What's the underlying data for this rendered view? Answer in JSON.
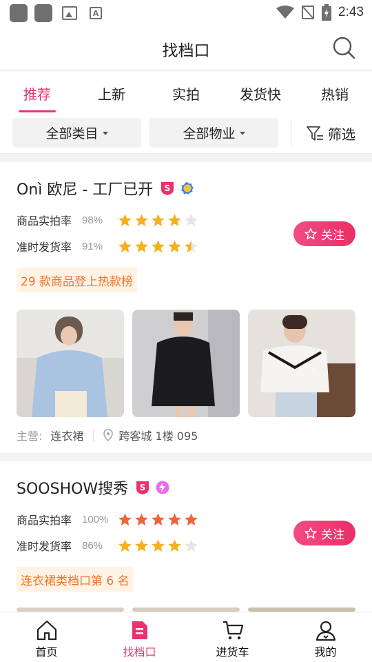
{
  "status_bar": {
    "time": "2:43"
  },
  "header": {
    "title": "找档口",
    "search_icon": "search-icon"
  },
  "tabs": [
    {
      "label": "推荐",
      "active": true
    },
    {
      "label": "上新",
      "active": false
    },
    {
      "label": "实拍",
      "active": false
    },
    {
      "label": "发货快",
      "active": false
    },
    {
      "label": "热销",
      "active": false
    }
  ],
  "filters": {
    "category_label": "全部类目",
    "property_label": "全部物业",
    "filter_label": "筛选"
  },
  "shops": [
    {
      "name": "Onì 欧尼 - 工厂已开",
      "photo_rate_label": "商品实拍率",
      "photo_rate_value": "98%",
      "photo_rate_stars": 4,
      "ontime_label": "准时发货率",
      "ontime_value": "91%",
      "ontime_stars": 4.5,
      "follow_label": "关注",
      "hot_tag": "29 款商品登上热款榜",
      "main_label": "主营:",
      "main_value": "连衣裙",
      "location": "跨客城 1楼 095"
    },
    {
      "name": "SOOSHOW搜秀",
      "photo_rate_label": "商品实拍率",
      "photo_rate_value": "100%",
      "photo_rate_stars": 5,
      "ontime_label": "准时发货率",
      "ontime_value": "86%",
      "ontime_stars": 4,
      "follow_label": "关注",
      "hot_tag": "连衣裙类档口第 6 名"
    }
  ],
  "bottom_nav": [
    {
      "label": "首页",
      "icon": "home-icon",
      "active": false
    },
    {
      "label": "找档口",
      "icon": "shop-finder-icon",
      "active": true
    },
    {
      "label": "进货车",
      "icon": "cart-icon",
      "active": false
    },
    {
      "label": "我的",
      "icon": "profile-icon",
      "active": false
    }
  ],
  "colors": {
    "accent": "#e8336c",
    "star": "#f5b01d",
    "star_red": "#f0643c",
    "hot_tag_text": "#f0742a"
  }
}
